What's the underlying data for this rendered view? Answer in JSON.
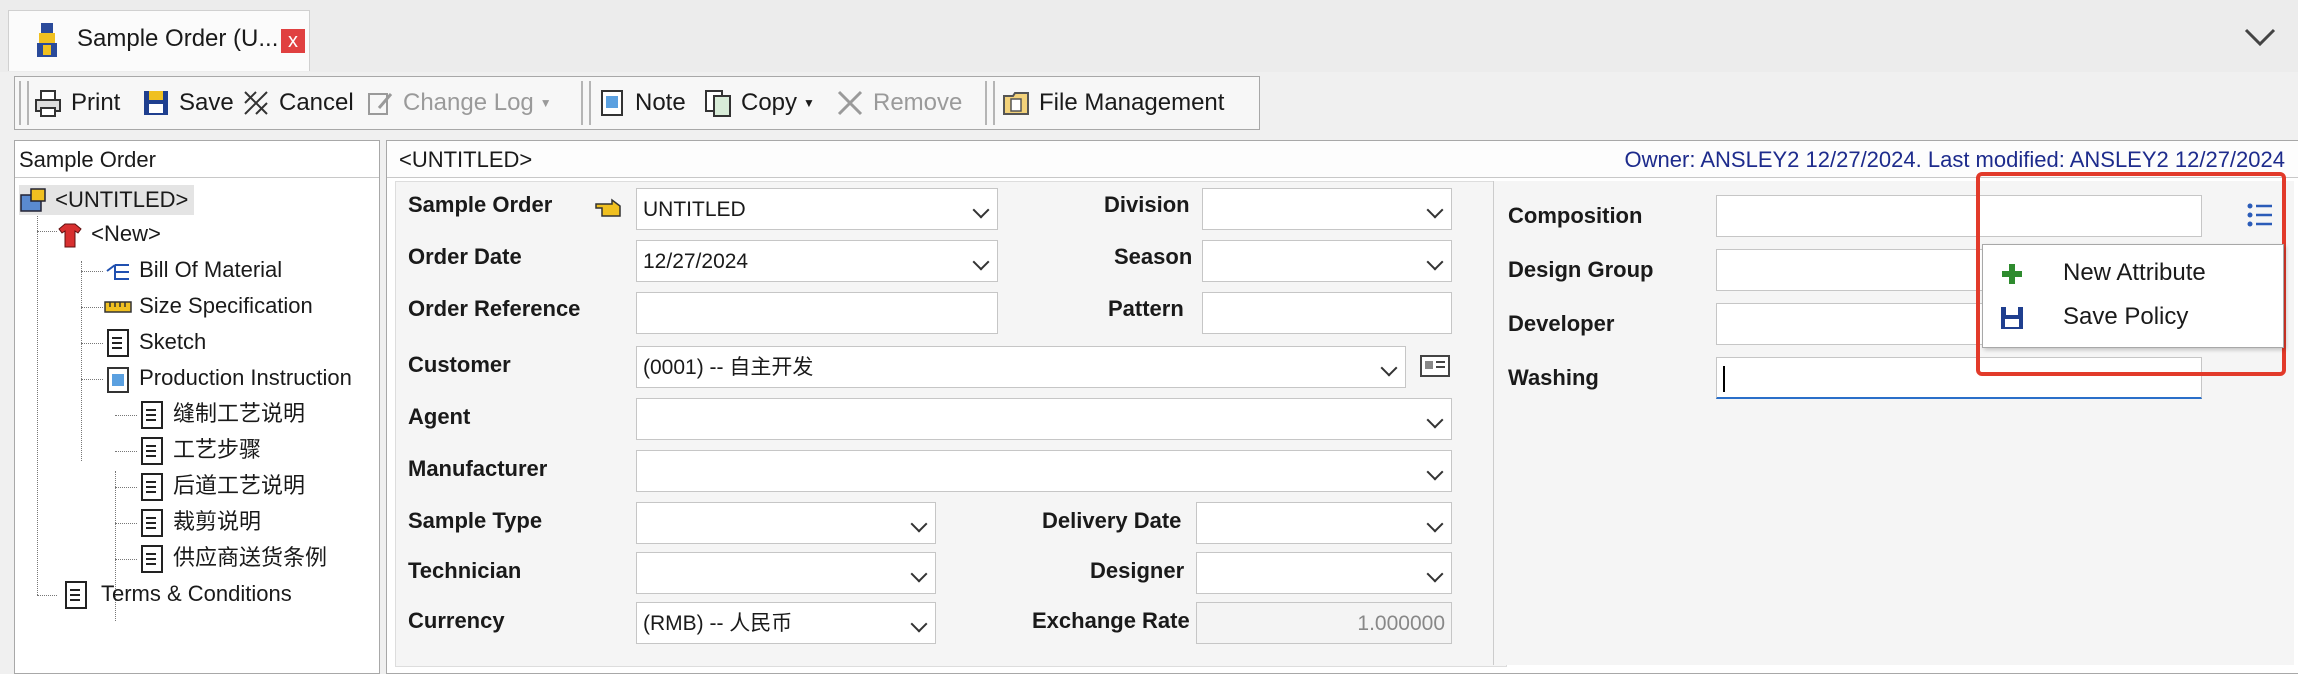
{
  "tab": {
    "title": "Sample Order (U...",
    "close_label": "x"
  },
  "toolbar": {
    "print": "Print",
    "save": "Save",
    "cancel": "Cancel",
    "change_log": "Change Log",
    "note": "Note",
    "copy": "Copy",
    "remove": "Remove",
    "file_management": "File Management"
  },
  "tree": {
    "title": "Sample Order",
    "root": "<UNTITLED>",
    "new": "<New>",
    "bill_of_material": "Bill Of Material",
    "size_specification": "Size Specification",
    "sketch": "Sketch",
    "production_instructions": "Production Instruction",
    "prod_children": [
      "缝制工艺说明",
      "工艺步骤",
      "后道工艺说明",
      "裁剪说明",
      "供应商送货条例"
    ],
    "terms": "Terms & Conditions"
  },
  "main": {
    "doc_title": "<UNTITLED>",
    "meta": "Owner: ANSLEY2 12/27/2024.  Last modified: ANSLEY2 12/27/2024"
  },
  "form": {
    "sample_order": {
      "label": "Sample Order",
      "value": "UNTITLED"
    },
    "order_date": {
      "label": "Order Date",
      "value": "12/27/2024"
    },
    "order_reference": {
      "label": "Order Reference",
      "value": ""
    },
    "customer": {
      "label": "Customer",
      "value": "(0001) -- 自主开发"
    },
    "agent": {
      "label": "Agent",
      "value": ""
    },
    "manufacturer": {
      "label": "Manufacturer",
      "value": ""
    },
    "sample_type": {
      "label": "Sample Type",
      "value": ""
    },
    "technician": {
      "label": "Technician",
      "value": ""
    },
    "currency": {
      "label": "Currency",
      "value": "(RMB) -- 人民币"
    },
    "division": {
      "label": "Division",
      "value": ""
    },
    "season": {
      "label": "Season",
      "value": ""
    },
    "pattern": {
      "label": "Pattern",
      "value": ""
    },
    "delivery_date": {
      "label": "Delivery Date",
      "value": ""
    },
    "designer": {
      "label": "Designer",
      "value": ""
    },
    "exchange_rate": {
      "label": "Exchange Rate",
      "value": "1.000000"
    }
  },
  "attributes": {
    "composition": {
      "label": "Composition",
      "value": ""
    },
    "design_group": {
      "label": "Design Group",
      "value": ""
    },
    "developer": {
      "label": "Developer",
      "value": ""
    },
    "washing": {
      "label": "Washing",
      "value": ""
    }
  },
  "popup_menu": {
    "new_attribute": "New Attribute",
    "save_policy": "Save Policy"
  },
  "colors": {
    "highlight": "#e23a2a",
    "meta_text": "#1d2b8c",
    "focus": "#2a6fc9",
    "add_icon": "#2e8b2e"
  }
}
